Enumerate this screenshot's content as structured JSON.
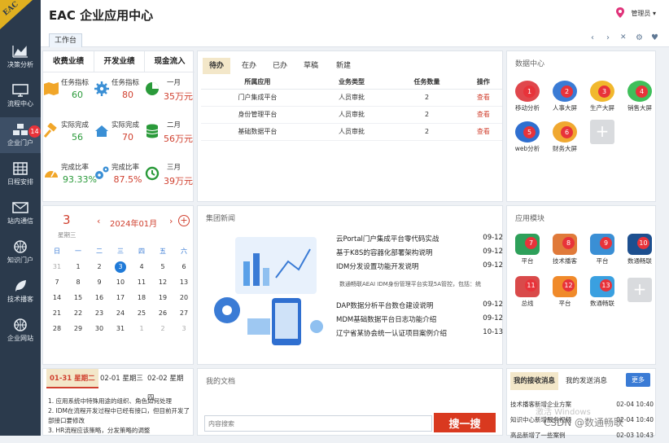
{
  "logo": "EAC",
  "app_title": "EAC 企业应用中心",
  "admin_label": "管理员",
  "tab": "工作台",
  "sidebar": [
    {
      "label": "决策分析"
    },
    {
      "label": "流程中心"
    },
    {
      "label": "企业门户",
      "badge": "14"
    },
    {
      "label": "日程安排"
    },
    {
      "label": "站内通信"
    },
    {
      "label": "知识门户"
    },
    {
      "label": "技术播客"
    },
    {
      "label": "企业网站"
    }
  ],
  "biz": {
    "headers": [
      "收费业绩",
      "开发业绩",
      "现金流入"
    ],
    "rows": [
      [
        {
          "label": "任务指标",
          "value": "60"
        },
        {
          "label": "任务指标",
          "value": "80"
        },
        {
          "label": "一月",
          "value": "35万元"
        }
      ],
      [
        {
          "label": "实际完成",
          "value": "56"
        },
        {
          "label": "实际完成",
          "value": "70"
        },
        {
          "label": "二月",
          "value": "56万元"
        }
      ],
      [
        {
          "label": "完成比率",
          "value": "93.33%"
        },
        {
          "label": "完成比率",
          "value": "87.5%"
        },
        {
          "label": "三月",
          "value": "39万元"
        }
      ]
    ]
  },
  "todo": {
    "tabs": [
      "待办",
      "在办",
      "已办",
      "草稿",
      "新建"
    ],
    "columns": [
      "所属应用",
      "业务类型",
      "任务数量",
      "操作"
    ],
    "rows": [
      {
        "app": "门户集成平台",
        "type": "人员审批",
        "count": "2",
        "op": "查看"
      },
      {
        "app": "身份管理平台",
        "type": "人员审批",
        "count": "2",
        "op": "查看"
      },
      {
        "app": "基础数据平台",
        "type": "人员审批",
        "count": "2",
        "op": "查看"
      }
    ]
  },
  "data_center": {
    "title": "数据中心",
    "items": [
      {
        "label": "移动分析",
        "badge": "1",
        "color": "#e0474c"
      },
      {
        "label": "人事大屏",
        "badge": "2",
        "color": "#3a7bd5"
      },
      {
        "label": "生产大屏",
        "badge": "3",
        "color": "#f1b82d"
      },
      {
        "label": "销售大屏",
        "badge": "4",
        "color": "#3fbf5a"
      },
      {
        "label": "web分析",
        "badge": "5",
        "color": "#2f6fd0"
      },
      {
        "label": "财务大屏",
        "badge": "6",
        "color": "#f0a830"
      }
    ]
  },
  "calendar": {
    "day": "3",
    "weekday": "星期三",
    "month": "2024年01月",
    "weekdays": [
      "日",
      "一",
      "二",
      "三",
      "四",
      "五",
      "六"
    ],
    "weeks": [
      [
        "31",
        "1",
        "2",
        "3",
        "4",
        "5",
        "6"
      ],
      [
        "7",
        "8",
        "9",
        "10",
        "11",
        "12",
        "13"
      ],
      [
        "14",
        "15",
        "16",
        "17",
        "18",
        "19",
        "20"
      ],
      [
        "21",
        "22",
        "23",
        "24",
        "25",
        "26",
        "27"
      ],
      [
        "28",
        "29",
        "30",
        "31",
        "1",
        "2",
        "3"
      ]
    ]
  },
  "news": {
    "title": "集团新闻",
    "items": [
      {
        "title": "云Portal门户集成平台零代码实战",
        "date": "09-12"
      },
      {
        "title": "基于K8S的容器化部署架构说明",
        "date": "09-12"
      },
      {
        "title": "IDM分发设置功能开发说明",
        "date": "09-12"
      }
    ],
    "summary": "数通畅联AEAI IDM身份管理平台实现5A管控，包括：统",
    "items2": [
      {
        "title": "DAP数据分析平台数仓建设说明",
        "date": "09-12"
      },
      {
        "title": "MDM基础数据平台日志功能介绍",
        "date": "09-12"
      },
      {
        "title": "辽宁省某协会统一认证项目案例介绍",
        "date": "10-13"
      }
    ]
  },
  "modules": {
    "title": "应用模块",
    "items": [
      {
        "label": "平台",
        "badge": "7",
        "color": "#2ea05a"
      },
      {
        "label": "技术播客",
        "badge": "8",
        "color": "#e07a3a"
      },
      {
        "label": "平台",
        "badge": "9",
        "color": "#3a8fd5"
      },
      {
        "label": "数通畅联",
        "badge": "10",
        "color": "#1d4f8f"
      },
      {
        "label": "总线",
        "badge": "11",
        "color": "#d94a4a"
      },
      {
        "label": "平台",
        "badge": "12",
        "color": "#f08a2a"
      },
      {
        "label": "数通畅联",
        "badge": "13",
        "color": "#3aa0e0"
      }
    ]
  },
  "schedule": {
    "tabs": [
      "01-31 星期二",
      "02-01 星期三",
      "02-02 星期四"
    ],
    "items": [
      "1. 应用系统中特殊用途的组织、角色如何处理",
      "2. IDM在流程开发过程中已经有接口，但目前开发了部接口要修改",
      "3. HR流程应该策略，分发策略的调整"
    ]
  },
  "docs": {
    "title": "我的文档",
    "search_placeholder": "内容搜索",
    "search_button": "搜一搜"
  },
  "messages": {
    "tabs": [
      "我的接收消息",
      "我的发送消息"
    ],
    "more": "更多",
    "items": [
      {
        "title": "技术播客新增企业方案",
        "date": "02-04 10:40"
      },
      {
        "title": "知识中心新增服务视频",
        "date": "02-04 10:40"
      },
      {
        "title": "高品新增了一些案例",
        "date": "02-03 10:43"
      }
    ]
  },
  "watermark": "激活 Windows",
  "credit": "CSDN @数通畅联"
}
